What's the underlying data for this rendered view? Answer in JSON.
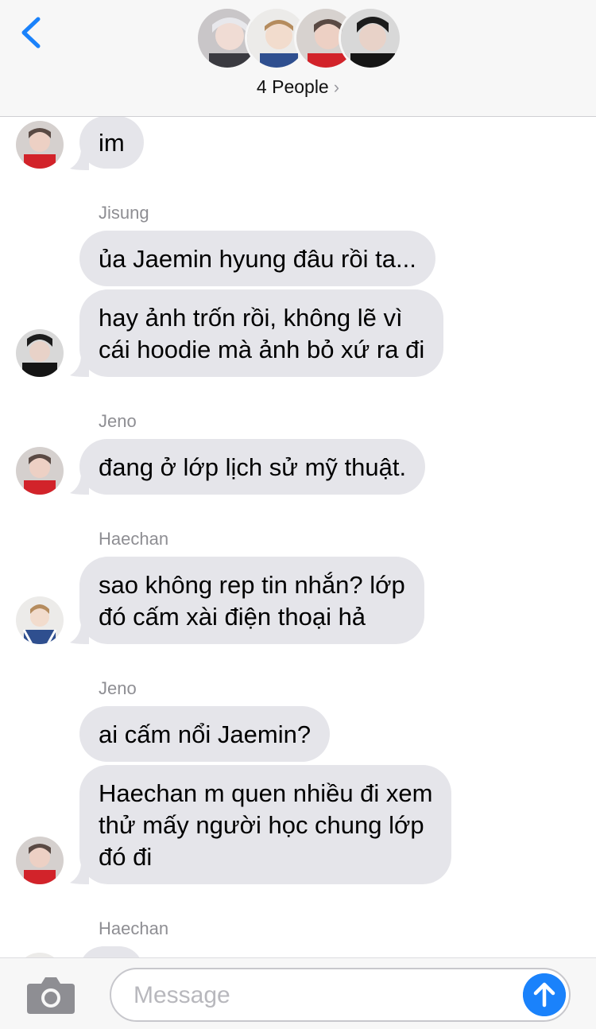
{
  "header": {
    "group_label": "4 People",
    "chevron": "›",
    "back_icon": "chevron-left-icon",
    "accent": "#1a82fb"
  },
  "messages": [
    {
      "sender": "",
      "text": "im"
    },
    {
      "sender": "Jisung",
      "text": "ủa Jaemin hyung đâu rồi ta..."
    },
    {
      "sender": "",
      "text": "hay ảnh trốn rồi, không lẽ vì\ncái hoodie mà ảnh bỏ xứ ra đi"
    },
    {
      "sender": "Jeno",
      "text": "đang ở lớp lịch sử mỹ thuật."
    },
    {
      "sender": "Haechan",
      "text": "sao không rep tin nhắn? lớp\nđó cấm xài điện thoại hả"
    },
    {
      "sender": "Jeno",
      "text": "ai cấm nổi Jaemin?"
    },
    {
      "sender": "",
      "text": "Haechan m quen nhiều đi xem\nthử mấy người học chung lớp\nđó đi"
    },
    {
      "sender": "Haechan",
      "text": ""
    }
  ],
  "composer": {
    "placeholder": "Message",
    "camera_icon": "camera-icon",
    "send_icon": "send-arrow-icon"
  },
  "colors": {
    "bubble": "#e5e5ea",
    "sender_name": "#8e8e93",
    "header_bg": "#f7f7f7"
  }
}
